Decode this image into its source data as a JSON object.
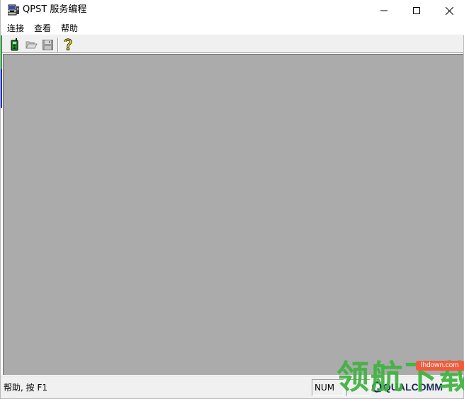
{
  "window": {
    "title": "QPST 服务编程"
  },
  "menu": {
    "items": [
      "连接",
      "查看",
      "帮助"
    ]
  },
  "toolbar": {
    "buttons": [
      {
        "icon": "phone-icon",
        "color": "#1a8a2a"
      },
      {
        "icon": "open-folder-icon"
      },
      {
        "icon": "save-icon"
      },
      {
        "icon": "help-icon"
      }
    ]
  },
  "status": {
    "message": "帮助, 按 F1",
    "num": "NUM",
    "brand": "QUALCOMM"
  },
  "watermark": {
    "text": "领航下载",
    "url": "lhdown.com",
    "color": "#3fb33f",
    "url_bg": "#f25a3c"
  },
  "colors": {
    "client_bg": "#ababab",
    "chrome_bg": "#f0f0f0"
  }
}
